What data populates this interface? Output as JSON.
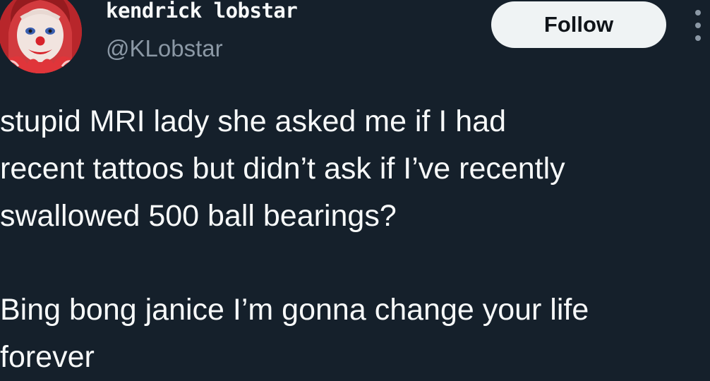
{
  "author": {
    "display_name": "kendrick lobstar",
    "handle": "@KLobstar"
  },
  "actions": {
    "follow_label": "Follow"
  },
  "icons": {
    "avatar": "clown-face-avatar",
    "more": "more-vertical-icon"
  },
  "tweet": {
    "paragraph1": [
      "stupid MRI lady she asked me if I had",
      "recent tattoos but didn’t ask if I’ve recently",
      "swallowed 500 ball bearings?"
    ],
    "paragraph2": [
      "Bing bong janice I’m gonna change your life",
      "forever"
    ]
  },
  "colors": {
    "background": "#15202b",
    "text_primary": "#f7f9f9",
    "text_secondary": "#8b98a5",
    "button_bg": "#eff3f4",
    "button_text": "#0f1419"
  }
}
